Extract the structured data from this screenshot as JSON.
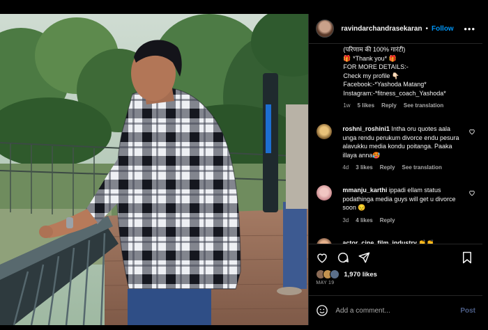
{
  "post": {
    "username": "ravindarchandrasekaran",
    "separator": "•",
    "follow_label": "Follow",
    "more_label": "•••"
  },
  "caption": {
    "lines": [
      "(परिणाम की 100% गारंटी)",
      "🎁 *Thank you* 🎁",
      "FOR MORE DETAILS:-",
      "Check my profile 👇🏻",
      "Facebook:-*Yashoda Matang*",
      "Instagram:-*fitness_coach_Yashoda*"
    ],
    "time": "1w",
    "likes": "5 likes",
    "reply": "Reply",
    "translate": "See translation"
  },
  "comments": [
    {
      "user": "roshni_roshini1",
      "text": "Intha oru quotes aala unga rendu perukum divorce endu pesura alavukku media kondu poitanga. Paaka illaya anna🥵",
      "time": "4d",
      "likes": "3 likes",
      "reply": "Reply",
      "translate": "See translation"
    },
    {
      "user": "mmanju_karthi",
      "text": "ippadi ellam status podathinga media guys will get u divorce soon 😔",
      "time": "3d",
      "likes": "4 likes",
      "reply": "Reply"
    },
    {
      "user": "actor_cine_film_industry",
      "text": "👏👏"
    }
  ],
  "actions": {
    "likes_count": "1,970 likes",
    "date": "MAY 19"
  },
  "add_comment": {
    "placeholder": "Add a comment...",
    "post_label": "Post"
  },
  "colors": {
    "background": "#000000",
    "link_blue": "#0095f6",
    "muted": "#a8a8a8"
  }
}
